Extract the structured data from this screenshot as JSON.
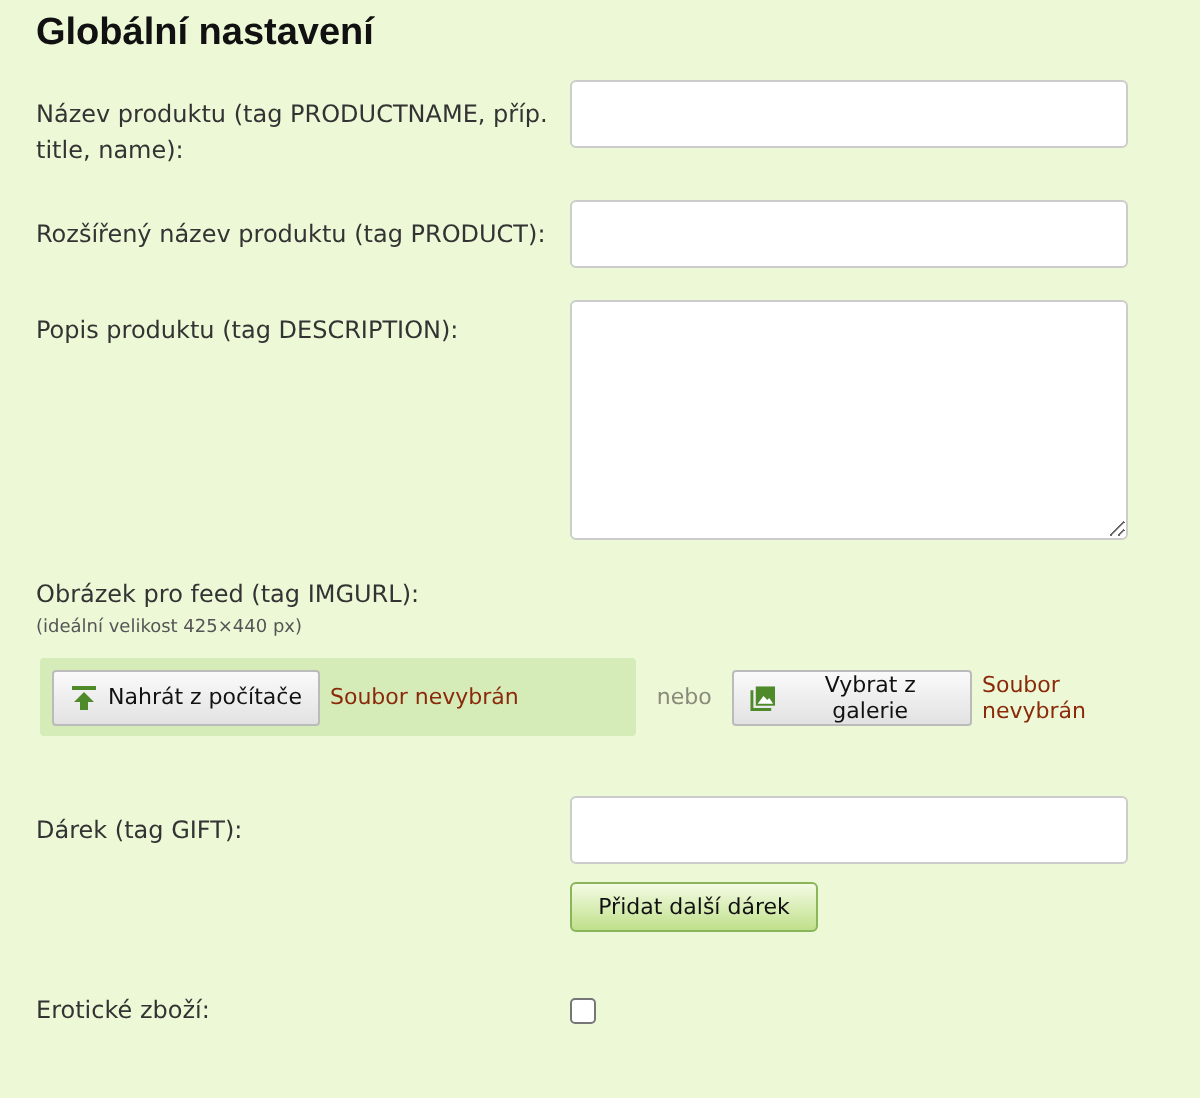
{
  "title": "Globální nastavení",
  "fields": [
    {
      "kind": "text",
      "label": "Název produktu (tag PRODUCTNAME, příp. title, name):"
    },
    {
      "kind": "text",
      "label": "Rozšířený název produktu (tag PRODUCT):"
    },
    {
      "kind": "textarea",
      "label": "Popis produktu (tag DESCRIPTION):"
    }
  ],
  "image": {
    "label": "Obrázek pro feed (tag IMGURL):",
    "hint": "(ideální velikost 425×440 px)",
    "upload_button": "Nahrát z počítače",
    "upload_status": "Soubor nevybrán",
    "separator": "nebo",
    "gallery_button": "Vybrat z galerie",
    "gallery_status": "Soubor nevybrán"
  },
  "gift": {
    "label": "Dárek (tag GIFT):",
    "add_button": "Přidat další dárek"
  },
  "erotic": {
    "label": "Erotické zboží:",
    "checked": false
  }
}
